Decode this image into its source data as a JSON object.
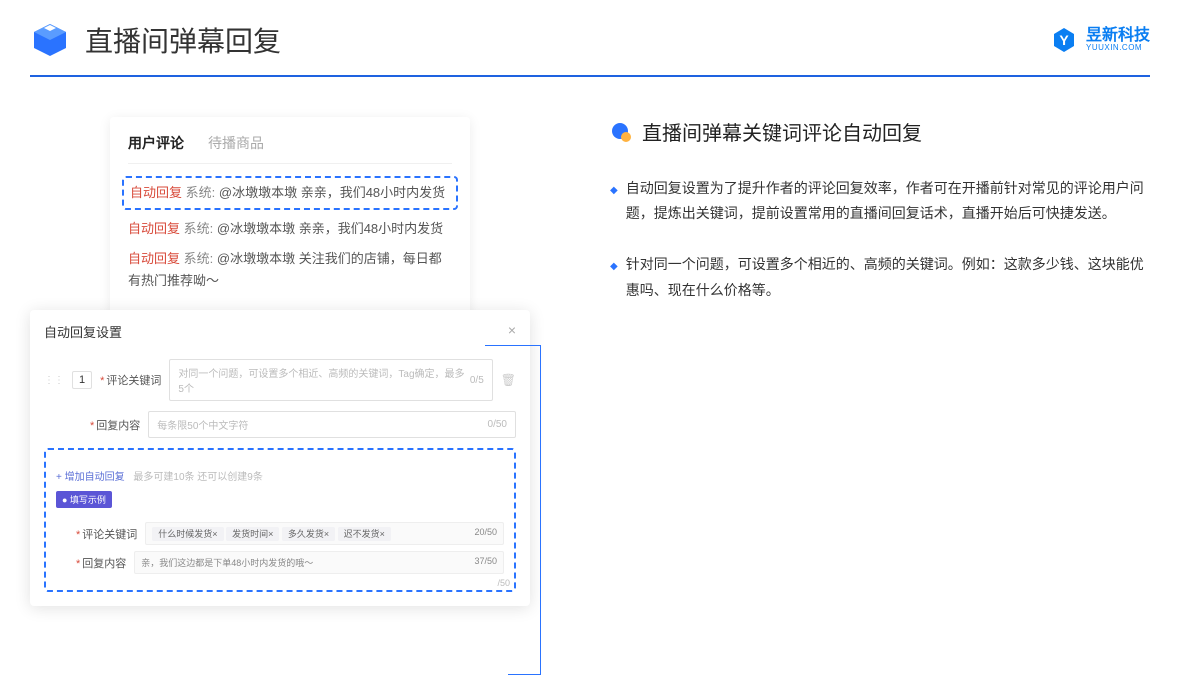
{
  "header": {
    "title": "直播间弹幕回复",
    "logo_main": "昱新科技",
    "logo_sub": "YUUXIN.COM"
  },
  "comment_panel": {
    "tab_active": "用户评论",
    "tab_inactive": "待播商品",
    "highlighted": {
      "tag": "自动回复",
      "sys": "系统:",
      "text": "@冰墩墩本墩 亲亲，我们48小时内发货"
    },
    "items": [
      {
        "tag": "自动回复",
        "sys": "系统:",
        "text": "@冰墩墩本墩 亲亲，我们48小时内发货"
      },
      {
        "tag": "自动回复",
        "sys": "系统:",
        "text": "@冰墩墩本墩 关注我们的店铺，每日都有热门推荐呦～"
      }
    ]
  },
  "settings": {
    "title": "自动回复设置",
    "row_num": "1",
    "label_keyword": "评论关键词",
    "placeholder_keyword": "对同一个问题，可设置多个相近、高频的关键词，Tag确定，最多5个",
    "counter_keyword": "0/5",
    "label_content": "回复内容",
    "placeholder_content": "每条限50个中文字符",
    "counter_content": "0/50",
    "add_text": "+ 增加自动回复",
    "add_hint": "最多可建10条 还可以创建9条",
    "example_badge": "● 填写示例",
    "example_label_kw": "评论关键词",
    "example_tags": [
      "什么时候发货×",
      "发货时间×",
      "多久发货×",
      "迟不发货×"
    ],
    "example_kw_counter": "20/50",
    "example_label_ct": "回复内容",
    "example_ct_value": "亲，我们这边都是下单48小时内发货的哦～",
    "example_ct_counter": "37/50",
    "outside_counter": "/50"
  },
  "right": {
    "sub_title": "直播间弹幕关键词评论自动回复",
    "bullets": [
      "自动回复设置为了提升作者的评论回复效率，作者可在开播前针对常见的评论用户问题，提炼出关键词，提前设置常用的直播间回复话术，直播开始后可快捷发送。",
      "针对同一个问题，可设置多个相近的、高频的关键词。例如：这款多少钱、这块能优惠吗、现在什么价格等。"
    ]
  }
}
